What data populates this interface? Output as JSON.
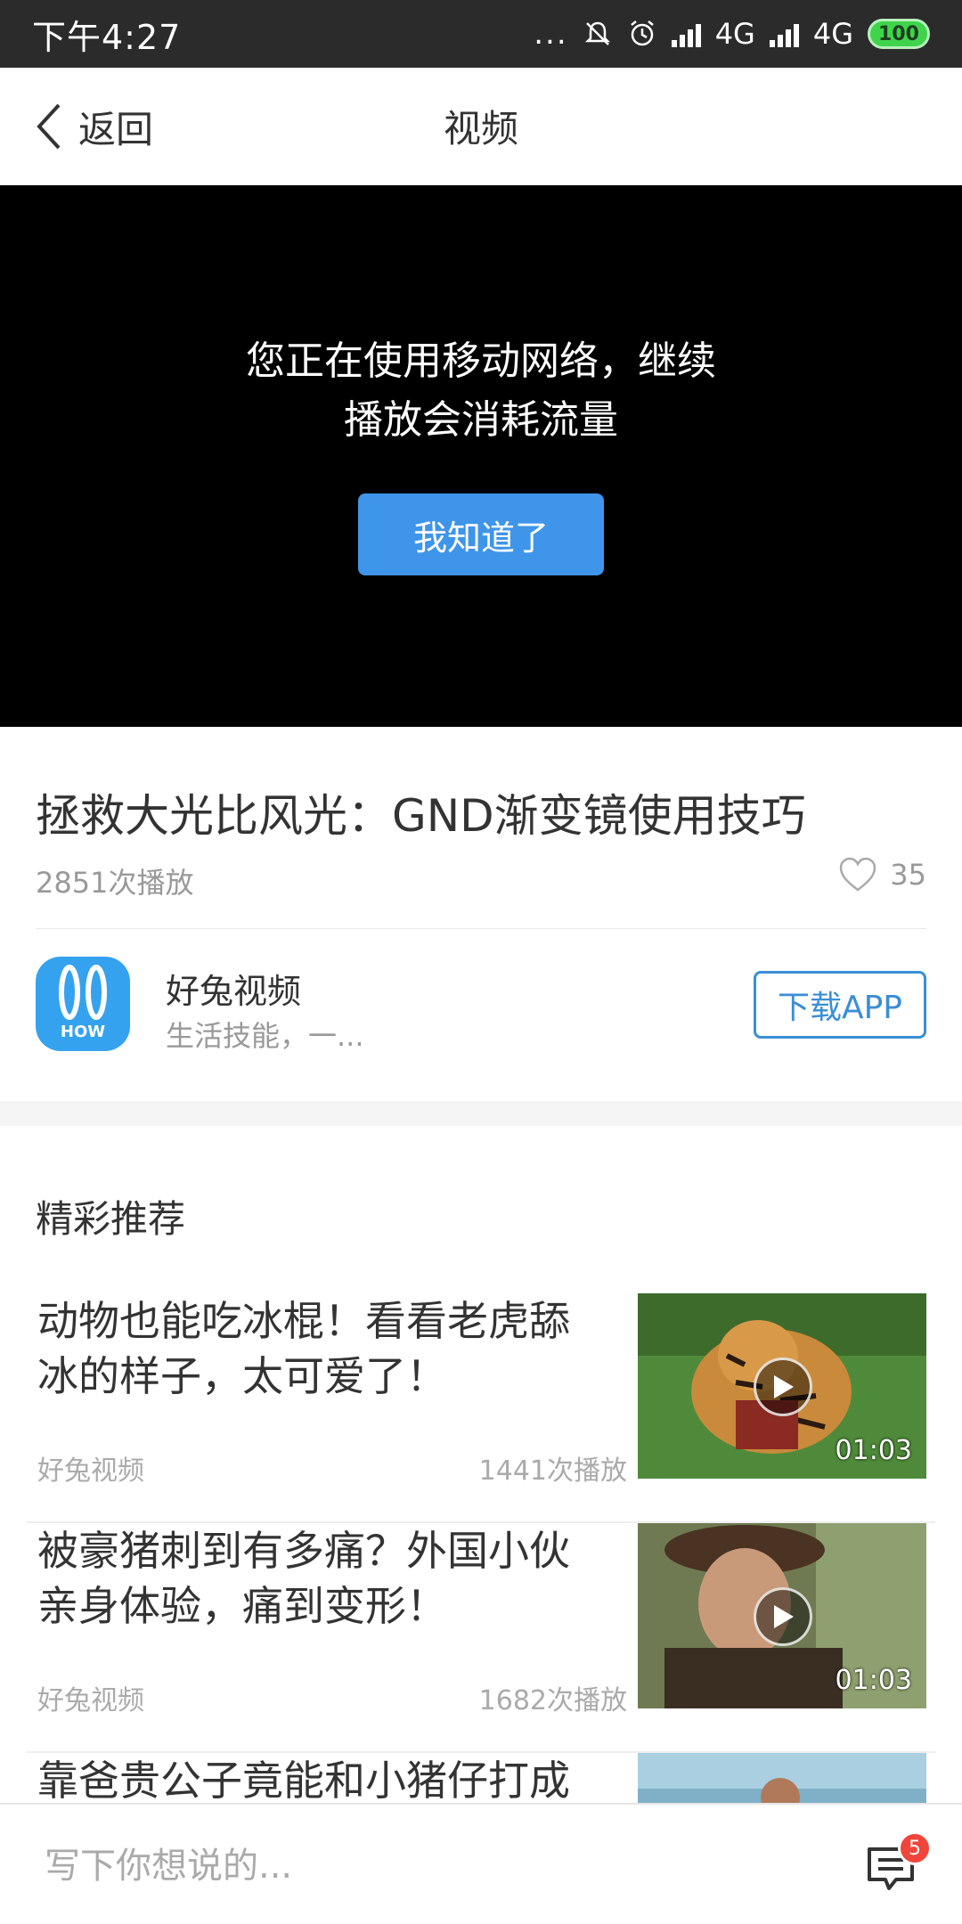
{
  "status_bar": {
    "time": "下午4:27",
    "dots": "...",
    "network_1": "4G",
    "network_2": "4G",
    "battery": "100"
  },
  "nav": {
    "back_label": "返回",
    "title": "视频"
  },
  "video": {
    "message_line1": "您正在使用移动网络，继续",
    "message_line2": "播放会消耗流量",
    "ack_button": "我知道了"
  },
  "info": {
    "title": "拯救大光比风光：GND渐变镜使用技巧",
    "plays": "2851次播放",
    "likes": "35"
  },
  "channel": {
    "logo_text": "HOW",
    "name": "好兔视频",
    "description": "生活技能，一...",
    "download_button": "下载APP"
  },
  "recommend": {
    "title": "精彩推荐",
    "items": [
      {
        "line1": "动物也能吃冰棍！看看老虎舔",
        "line2": "冰的样子，太可爱了！",
        "source": "好兔视频",
        "plays": "1441次播放",
        "duration": "01:03"
      },
      {
        "line1": "被豪猪刺到有多痛？外国小伙",
        "line2": "亲身体验，痛到变形！",
        "source": "好兔视频",
        "plays": "1682次播放",
        "duration": "01:03"
      },
      {
        "line1": "靠爸贵公子竟能和小猪仔打成",
        "line2": "",
        "source": "",
        "plays": "",
        "duration": ""
      }
    ]
  },
  "comment_bar": {
    "placeholder": "写下你想说的...",
    "badge_count": "5"
  }
}
